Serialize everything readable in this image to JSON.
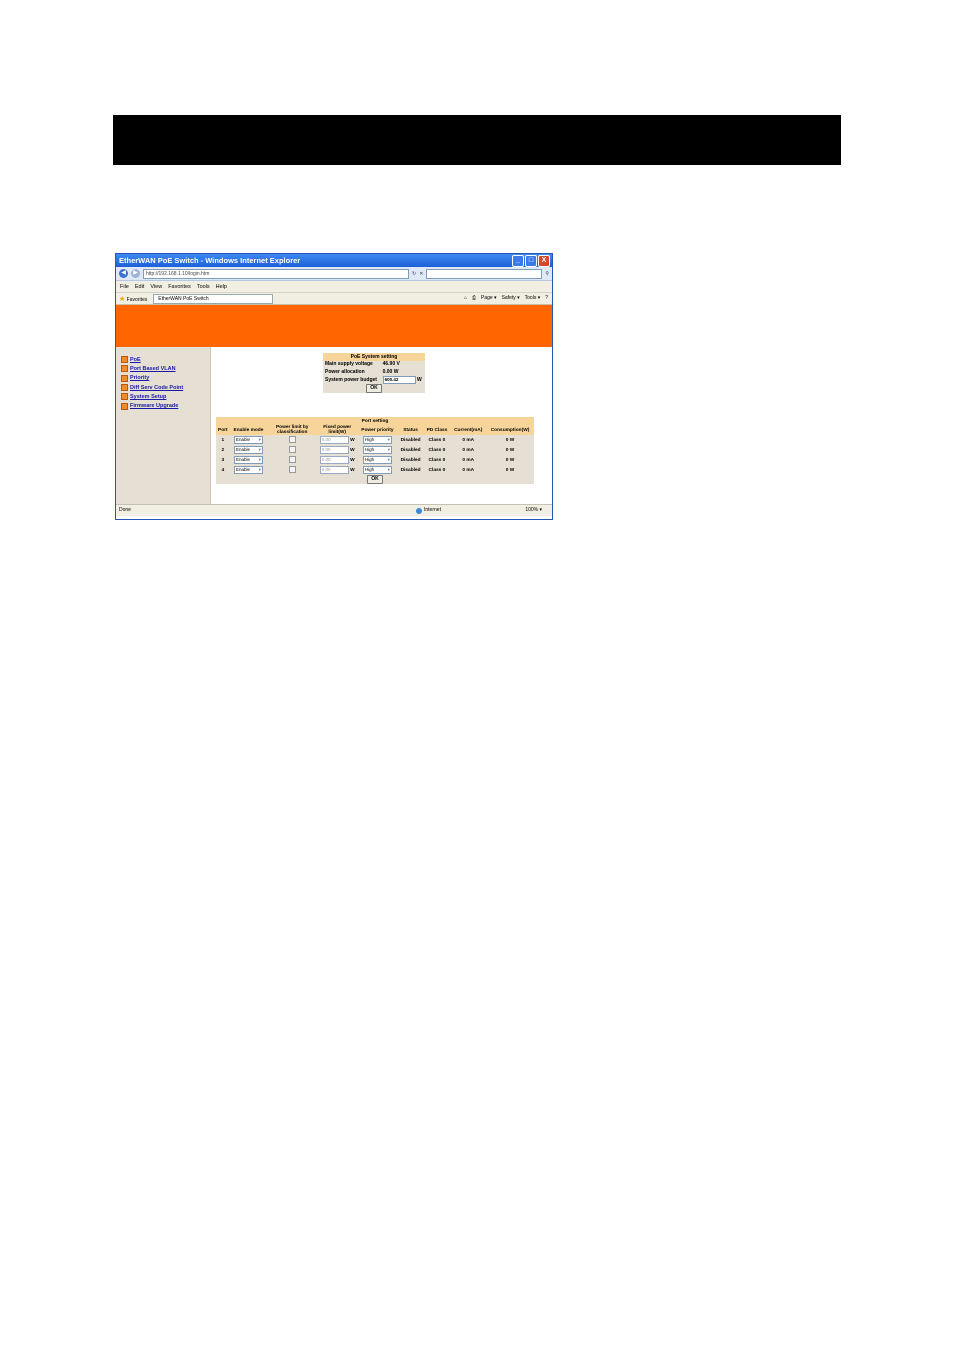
{
  "window": {
    "title": "EtherWAN PoE Switch - Windows Internet Explorer",
    "controls": [
      "_",
      "□",
      "X"
    ]
  },
  "address": {
    "url": "http://192.168.1.10/login.htm"
  },
  "menu": [
    "File",
    "Edit",
    "View",
    "Favorites",
    "Tools",
    "Help"
  ],
  "favbar": {
    "favorites": "Favorites",
    "tab": "EtherWAN PoE Switch",
    "commands": [
      "Page ▾",
      "Safety ▾",
      "Tools ▾",
      "?"
    ]
  },
  "nav": [
    "PoE",
    "Port Based VLAN",
    "Priority",
    "Diff Serv Code Point",
    "System Setup",
    "Firmware Upgrade"
  ],
  "system": {
    "title": "PoE System setting",
    "main_supply_label": "Main supply voltage",
    "main_supply_value": "46.90 V",
    "power_alloc_label": "Power allocation",
    "power_alloc_value": "0.00 W",
    "budget_label": "System power budget",
    "budget_value": "600.42",
    "budget_unit": "W",
    "ok": "OK"
  },
  "ports": {
    "title": "Port setting",
    "headers": [
      "Port",
      "Enable mode",
      "Power limit by classification",
      "Fixed power limit(W)",
      "Power priority",
      "Status",
      "PD Class",
      "Current(mA)",
      "Consumption(W)"
    ],
    "unit": "W",
    "rows": [
      {
        "port": "1",
        "mode": "Enable",
        "limit": "0.00",
        "priority": "High",
        "status": "Disabled",
        "pd_class": "Class 0",
        "current": "0 mA",
        "consumption": "0 W"
      },
      {
        "port": "2",
        "mode": "Enable",
        "limit": "0.00",
        "priority": "High",
        "status": "Disabled",
        "pd_class": "Class 0",
        "current": "0 mA",
        "consumption": "0 W"
      },
      {
        "port": "3",
        "mode": "Enable",
        "limit": "0.00",
        "priority": "High",
        "status": "Disabled",
        "pd_class": "Class 0",
        "current": "0 mA",
        "consumption": "0 W"
      },
      {
        "port": "4",
        "mode": "Enable",
        "limit": "0.00",
        "priority": "High",
        "status": "Disabled",
        "pd_class": "Class 0",
        "current": "0 mA",
        "consumption": "0 W"
      }
    ],
    "ok": "OK"
  },
  "statusbar": {
    "left": "Done",
    "zone": "Internet",
    "zoom": "100% ▾"
  },
  "colors": {
    "banner": "#ff6600",
    "header_cell": "#f7d59a",
    "cell": "#e6dfd3",
    "link": "#1a1aa8"
  }
}
